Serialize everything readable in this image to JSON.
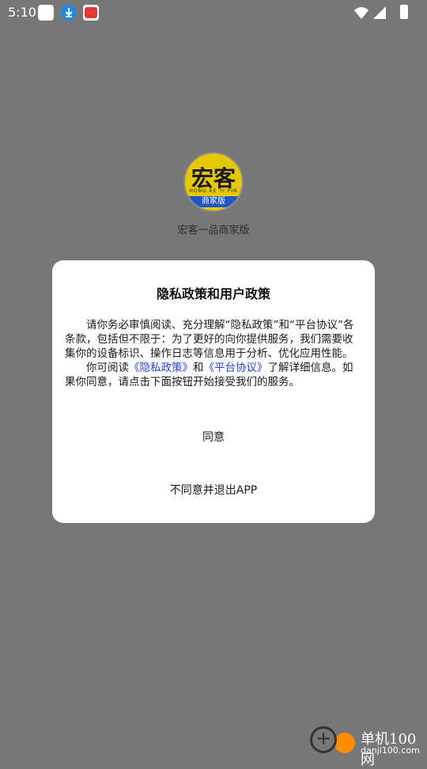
{
  "status_bar": {
    "time": "5:10"
  },
  "splash": {
    "logo_text": "宏客",
    "logo_subtext": "HONG KE YI PIN",
    "logo_band": "商家版",
    "app_name": "宏客一品商家版"
  },
  "dialog": {
    "title": "隐私政策和用户政策",
    "paragraph1": "请你务必审慎阅读、充分理解“隐私政策”和“平台协议”各条款，包括但不限于：为了更好的向你提供服务，我们需要收集你的设备标识、操作日志等信息用于分析、优化应用性能。",
    "p2_prefix": "你可阅读",
    "privacy_link": "《隐私政策》",
    "p2_and": "和",
    "agreement_link": "《平台协议》",
    "p2_suffix": "了解详细信息。如果你同意，请点击下面按钮开始接受我们的服务。",
    "agree_button": "同意",
    "exit_button": "不同意并退出APP"
  },
  "watermark": {
    "title": "单机100网",
    "url": "danji100.com"
  },
  "colors": {
    "overlay": "#777777",
    "link": "#2a3fd8",
    "logo_yellow": "#e6c800",
    "logo_blue": "#1d57c8"
  }
}
